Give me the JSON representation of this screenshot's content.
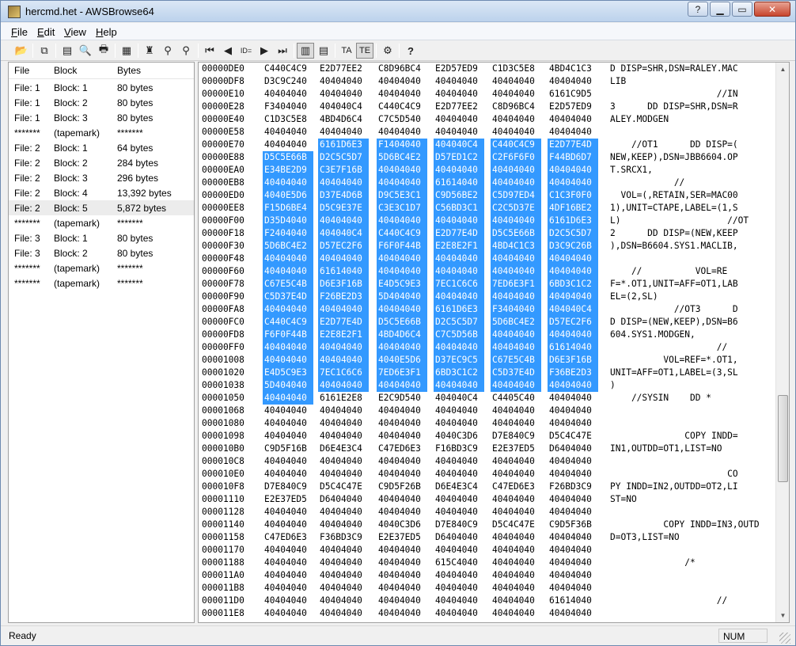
{
  "window": {
    "title": "hercmd.het - AWSBrowse64",
    "help": "?",
    "minimize": "▁",
    "maximize": "▭",
    "close": "✕"
  },
  "menu": [
    "File",
    "Edit",
    "View",
    "Help"
  ],
  "toolbar": {
    "icons": [
      "open-icon",
      "copy-icon",
      "properties-icon",
      "print-preview-icon",
      "print-icon",
      "export-icon",
      "find-icon",
      "find-next-icon",
      "find-prev-icon",
      "first-block-icon",
      "prev-block-icon",
      "goto-block-icon",
      "next-block-icon",
      "last-block-icon",
      "hex-view-icon",
      "text-view-icon",
      "ascii-icon",
      "ebcdic-icon",
      "options-icon",
      "about-icon"
    ],
    "glyphs": {
      "open": "📂",
      "copy": "⧉",
      "properties": "▤",
      "print_preview": "🔍",
      "print": "🖶",
      "export": "▦",
      "find": "♜",
      "find_next": "⚲",
      "find_prev": "⚲",
      "first": "⏮",
      "prev": "◀",
      "goto": "ID=",
      "next": "▶",
      "last": "⏭",
      "hex_view": "▥",
      "text_view": "▤",
      "ascii": "TA",
      "ebcdic": "TE",
      "options": "⚙",
      "about": "?"
    }
  },
  "file_list": {
    "columns": [
      "File",
      "Block",
      "Bytes"
    ],
    "rows": [
      [
        "File: 1",
        "Block: 1",
        "80 bytes"
      ],
      [
        "File: 1",
        "Block: 2",
        "80 bytes"
      ],
      [
        "File: 1",
        "Block: 3",
        "80 bytes"
      ],
      [
        "*******",
        "(tapemark)",
        "*******"
      ],
      [
        "File: 2",
        "Block: 1",
        "64 bytes"
      ],
      [
        "File: 2",
        "Block: 2",
        "284 bytes"
      ],
      [
        "File: 2",
        "Block: 3",
        "296 bytes"
      ],
      [
        "File: 2",
        "Block: 4",
        "13,392 bytes"
      ],
      [
        "File: 2",
        "Block: 5",
        "5,872 bytes"
      ],
      [
        "*******",
        "(tapemark)",
        "*******"
      ],
      [
        "File: 3",
        "Block: 1",
        "80 bytes"
      ],
      [
        "File: 3",
        "Block: 2",
        "80 bytes"
      ],
      [
        "*******",
        "(tapemark)",
        "*******"
      ],
      [
        "*******",
        "(tapemark)",
        "*******"
      ]
    ],
    "selected_index": 8
  },
  "hex_dump": {
    "rows": [
      [
        "00000DE0",
        "C440C4C9",
        "E2D77EE2",
        "C8D96BC4",
        "E2D57ED9",
        "C1D3C5E8",
        "4BD4C1C3",
        "D DISP=SHR,DSN=RALEY.MAC"
      ],
      [
        "00000DF8",
        "D3C9C240",
        "40404040",
        "40404040",
        "40404040",
        "40404040",
        "40404040",
        "LIB"
      ],
      [
        "00000E10",
        "40404040",
        "40404040",
        "40404040",
        "40404040",
        "40404040",
        "6161C9D5",
        "                    //IN"
      ],
      [
        "00000E28",
        "F3404040",
        "404040C4",
        "C440C4C9",
        "E2D77EE2",
        "C8D96BC4",
        "E2D57ED9",
        "3      DD DISP=SHR,DSN=R"
      ],
      [
        "00000E40",
        "C1D3C5E8",
        "4BD4D6C4",
        "C7C5D540",
        "40404040",
        "40404040",
        "40404040",
        "ALEY.MODGEN"
      ],
      [
        "00000E58",
        "40404040",
        "40404040",
        "40404040",
        "40404040",
        "40404040",
        "40404040",
        ""
      ],
      [
        "00000E70",
        "40404040",
        "6161D6E3",
        "F1404040",
        "404040C4",
        "C440C4C9",
        "E2D77E4D",
        "    //OT1      DD DISP=("
      ],
      [
        "00000E88",
        "D5C5E66B",
        "D2C5C5D7",
        "5D6BC4E2",
        "D57ED1C2",
        "C2F6F6F0",
        "F44BD6D7",
        "NEW,KEEP),DSN=JBB6604.OP"
      ],
      [
        "00000EA0",
        "E34BE2D9",
        "C3E7F16B",
        "40404040",
        "40404040",
        "40404040",
        "40404040",
        "T.SRCX1,"
      ],
      [
        "00000EB8",
        "40404040",
        "40404040",
        "40404040",
        "61614040",
        "40404040",
        "40404040",
        "            //"
      ],
      [
        "00000ED0",
        "4040E5D6",
        "D37E4D6B",
        "D9C5E3C1",
        "C9D56BE2",
        "C5D97ED4",
        "C1C3F0F0",
        "  VOL=(,RETAIN,SER=MAC00"
      ],
      [
        "00000EE8",
        "F15D6BE4",
        "D5C9E37E",
        "C3E3C1D7",
        "C56BD3C1",
        "C2C5D37E",
        "4DF16BE2",
        "1),UNIT=CTAPE,LABEL=(1,S"
      ],
      [
        "00000F00",
        "D35D4040",
        "40404040",
        "40404040",
        "40404040",
        "40404040",
        "6161D6E3",
        "L)                    //OT"
      ],
      [
        "00000F18",
        "F2404040",
        "404040C4",
        "C440C4C9",
        "E2D77E4D",
        "D5C5E66B",
        "D2C5C5D7",
        "2      DD DISP=(NEW,KEEP"
      ],
      [
        "00000F30",
        "5D6BC4E2",
        "D57EC2F6",
        "F6F0F44B",
        "E2E8E2F1",
        "4BD4C1C3",
        "D3C9C26B",
        "),DSN=B6604.SYS1.MACLIB,"
      ],
      [
        "00000F48",
        "40404040",
        "40404040",
        "40404040",
        "40404040",
        "40404040",
        "40404040",
        ""
      ],
      [
        "00000F60",
        "40404040",
        "61614040",
        "40404040",
        "40404040",
        "40404040",
        "40404040",
        "    //          VOL=RE"
      ],
      [
        "00000F78",
        "C67E5C4B",
        "D6E3F16B",
        "E4D5C9E3",
        "7EC1C6C6",
        "7ED6E3F1",
        "6BD3C1C2",
        "F=*.OT1,UNIT=AFF=OT1,LAB"
      ],
      [
        "00000F90",
        "C5D37E4D",
        "F26BE2D3",
        "5D404040",
        "40404040",
        "40404040",
        "40404040",
        "EL=(2,SL)"
      ],
      [
        "00000FA8",
        "40404040",
        "40404040",
        "40404040",
        "6161D6E3",
        "F3404040",
        "404040C4",
        "            //OT3      D"
      ],
      [
        "00000FC0",
        "C440C4C9",
        "E2D77E4D",
        "D5C5E66B",
        "D2C5C5D7",
        "5D6BC4E2",
        "D57EC2F6",
        "D DISP=(NEW,KEEP),DSN=B6"
      ],
      [
        "00000FD8",
        "F6F0F44B",
        "E2E8E2F1",
        "4BD4D6C4",
        "C7C5D56B",
        "40404040",
        "40404040",
        "604.SYS1.MODGEN,"
      ],
      [
        "00000FF0",
        "40404040",
        "40404040",
        "40404040",
        "40404040",
        "40404040",
        "61614040",
        "                    //"
      ],
      [
        "00001008",
        "40404040",
        "40404040",
        "4040E5D6",
        "D37EC9C5",
        "C67E5C4B",
        "D6E3F16B",
        "          VOL=REF=*.OT1,"
      ],
      [
        "00001020",
        "E4D5C9E3",
        "7EC1C6C6",
        "7ED6E3F1",
        "6BD3C1C2",
        "C5D37E4D",
        "F36BE2D3",
        "UNIT=AFF=OT1,LABEL=(3,SL"
      ],
      [
        "00001038",
        "5D404040",
        "40404040",
        "40404040",
        "40404040",
        "40404040",
        "40404040",
        ")"
      ],
      [
        "00001050",
        "40404040",
        "6161E2E8",
        "E2C9D540",
        "404040C4",
        "C4405C40",
        "40404040",
        "    //SYSIN    DD *"
      ],
      [
        "00001068",
        "40404040",
        "40404040",
        "40404040",
        "40404040",
        "40404040",
        "40404040",
        ""
      ],
      [
        "00001080",
        "40404040",
        "40404040",
        "40404040",
        "40404040",
        "40404040",
        "40404040",
        ""
      ],
      [
        "00001098",
        "40404040",
        "40404040",
        "40404040",
        "4040C3D6",
        "D7E840C9",
        "D5C4C47E",
        "              COPY INDD="
      ],
      [
        "000010B0",
        "C9D5F16B",
        "D6E4E3C4",
        "C47ED6E3",
        "F16BD3C9",
        "E2E37ED5",
        "D6404040",
        "IN1,OUTDD=OT1,LIST=NO"
      ],
      [
        "000010C8",
        "40404040",
        "40404040",
        "40404040",
        "40404040",
        "40404040",
        "40404040",
        ""
      ],
      [
        "000010E0",
        "40404040",
        "40404040",
        "40404040",
        "40404040",
        "40404040",
        "40404040",
        "                      CO"
      ],
      [
        "000010F8",
        "D7E840C9",
        "D5C4C47E",
        "C9D5F26B",
        "D6E4E3C4",
        "C47ED6E3",
        "F26BD3C9",
        "PY INDD=IN2,OUTDD=OT2,LI"
      ],
      [
        "00001110",
        "E2E37ED5",
        "D6404040",
        "40404040",
        "40404040",
        "40404040",
        "40404040",
        "ST=NO"
      ],
      [
        "00001128",
        "40404040",
        "40404040",
        "40404040",
        "40404040",
        "40404040",
        "40404040",
        ""
      ],
      [
        "00001140",
        "40404040",
        "40404040",
        "4040C3D6",
        "D7E840C9",
        "D5C4C47E",
        "C9D5F36B",
        "          COPY INDD=IN3,OUTD"
      ],
      [
        "00001158",
        "C47ED6E3",
        "F36BD3C9",
        "E2E37ED5",
        "D6404040",
        "40404040",
        "40404040",
        "D=OT3,LIST=NO"
      ],
      [
        "00001170",
        "40404040",
        "40404040",
        "40404040",
        "40404040",
        "40404040",
        "40404040",
        ""
      ],
      [
        "00001188",
        "40404040",
        "40404040",
        "40404040",
        "615C4040",
        "40404040",
        "40404040",
        "              /*"
      ],
      [
        "000011A0",
        "40404040",
        "40404040",
        "40404040",
        "40404040",
        "40404040",
        "40404040",
        ""
      ],
      [
        "000011B8",
        "40404040",
        "40404040",
        "40404040",
        "40404040",
        "40404040",
        "40404040",
        ""
      ],
      [
        "000011D0",
        "40404040",
        "40404040",
        "40404040",
        "40404040",
        "40404040",
        "61614040",
        "                    //"
      ],
      [
        "000011E8",
        "40404040",
        "40404040",
        "40404040",
        "40404040",
        "40404040",
        "40404040",
        ""
      ]
    ]
  },
  "status": {
    "text": "Ready",
    "num": "NUM"
  }
}
